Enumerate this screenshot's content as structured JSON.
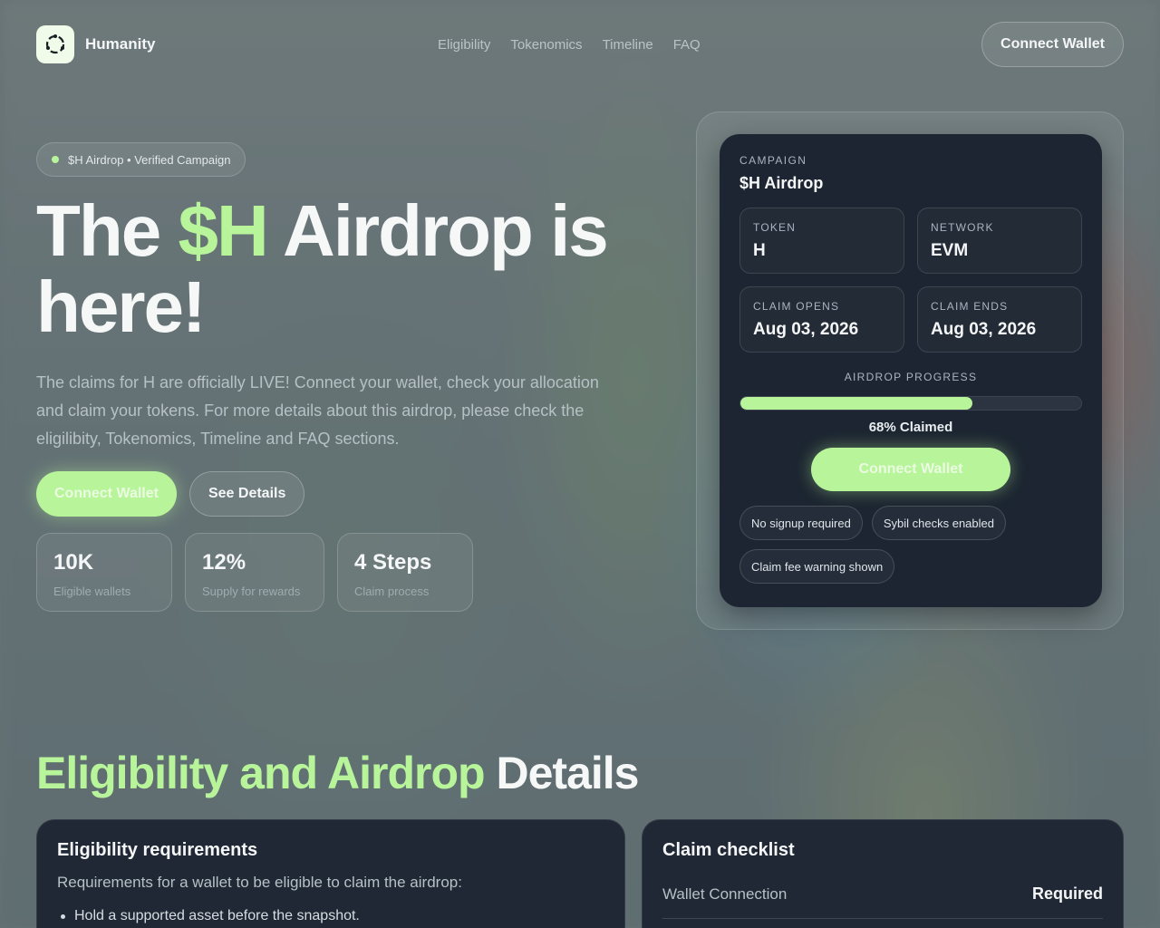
{
  "brand": {
    "name": "Humanity",
    "logo_icon": "humanity-ring-icon"
  },
  "nav": [
    {
      "label": "Eligibility"
    },
    {
      "label": "Tokenomics"
    },
    {
      "label": "Timeline"
    },
    {
      "label": "FAQ"
    }
  ],
  "header": {
    "connect_label": "Connect Wallet"
  },
  "hero": {
    "badge": "$H Airdrop • Verified Campaign",
    "title_pre": "The ",
    "title_accent": "$H",
    "title_post": " Airdrop is here!",
    "lead": "The claims for H are officially LIVE! Connect your wallet, check your allocation and claim your tokens. For more details about this airdrop, please check the eligilibity, Tokenomics, Timeline and FAQ sections.",
    "primary_cta": "Connect Wallet",
    "secondary_cta": "See Details",
    "stats": [
      {
        "value": "10K",
        "label": "Eligible wallets"
      },
      {
        "value": "12%",
        "label": "Supply for rewards"
      },
      {
        "value": "4 Steps",
        "label": "Claim process"
      }
    ]
  },
  "campaign": {
    "eyebrow": "CAMPAIGN",
    "name": "$H Airdrop",
    "fields": [
      {
        "key": "TOKEN",
        "value": "H"
      },
      {
        "key": "NETWORK",
        "value": "EVM"
      },
      {
        "key": "CLAIM OPENS",
        "value": "Aug 03, 2026"
      },
      {
        "key": "CLAIM ENDS",
        "value": "Aug 03, 2026"
      }
    ],
    "progress_label": "AIRDROP PROGRESS",
    "progress_fraction": 0.68,
    "progress_text": "68% Claimed",
    "cta": "Connect Wallet",
    "tags": [
      "No signup required",
      "Sybil checks enabled",
      "Claim fee warning shown"
    ]
  },
  "section": {
    "title_accent": "Eligibility and Airdrop",
    "title_post": " Details"
  },
  "eligibility": {
    "title": "Eligibility requirements",
    "subtitle": "Requirements for a wallet to be eligible to claim the airdrop:",
    "items": [
      "Hold a supported asset before the snapshot."
    ]
  },
  "checklist": {
    "title": "Claim checklist",
    "rows": [
      {
        "key": "Wallet Connection",
        "value": "Required"
      }
    ]
  },
  "colors": {
    "accent": "#b8f59a",
    "card": "#1c2531"
  }
}
